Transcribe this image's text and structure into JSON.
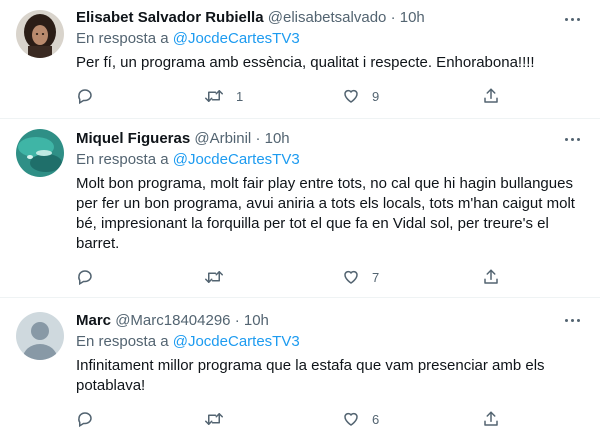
{
  "tweets": [
    {
      "name": "Elisabet Salvador Rubiella",
      "handle": "@elisabetsalvado",
      "separator": "·",
      "time": "10h",
      "reply_prefix": "En resposta a",
      "reply_to": "@JocdeCartesTV3",
      "text": "Per fí, un programa amb essència, qualitat i respecte. Enhorabona!!!!",
      "retweets": "1",
      "likes": "9",
      "avatar": "photo-woman-dark-hair"
    },
    {
      "name": "Miquel Figueras",
      "handle": "@Arbinil",
      "separator": "·",
      "time": "10h",
      "reply_prefix": "En resposta a",
      "reply_to": "@JocdeCartesTV3",
      "text": "Molt bon programa, molt fair play entre tots, no cal que hi hagin bullangues per fer un bon programa, avui aniria a tots els locals, tots m'han caigut molt bé, impresionant la forquilla per tot el que fa en Vidal sol, per treure's el barret.",
      "retweets": "",
      "likes": "7",
      "avatar": "photo-teal-water"
    },
    {
      "name": "Marc",
      "handle": "@Marc18404296",
      "separator": "·",
      "time": "10h",
      "reply_prefix": "En resposta a",
      "reply_to": "@JocdeCartesTV3",
      "text": "Infinitament millor programa que la estafa que vam presenciar amb els potablava!",
      "retweets": "",
      "likes": "6",
      "avatar": "default-profile"
    }
  ],
  "colors": {
    "text": "#0f1419",
    "secondary": "#536471",
    "mention": "#1d9bf0",
    "divider": "#eff3f4",
    "default_avatar_bg": "#cfd9de",
    "default_avatar_fg": "#8899a6"
  },
  "icons": [
    "more-icon",
    "reply-icon",
    "retweet-icon",
    "like-icon",
    "share-icon"
  ]
}
